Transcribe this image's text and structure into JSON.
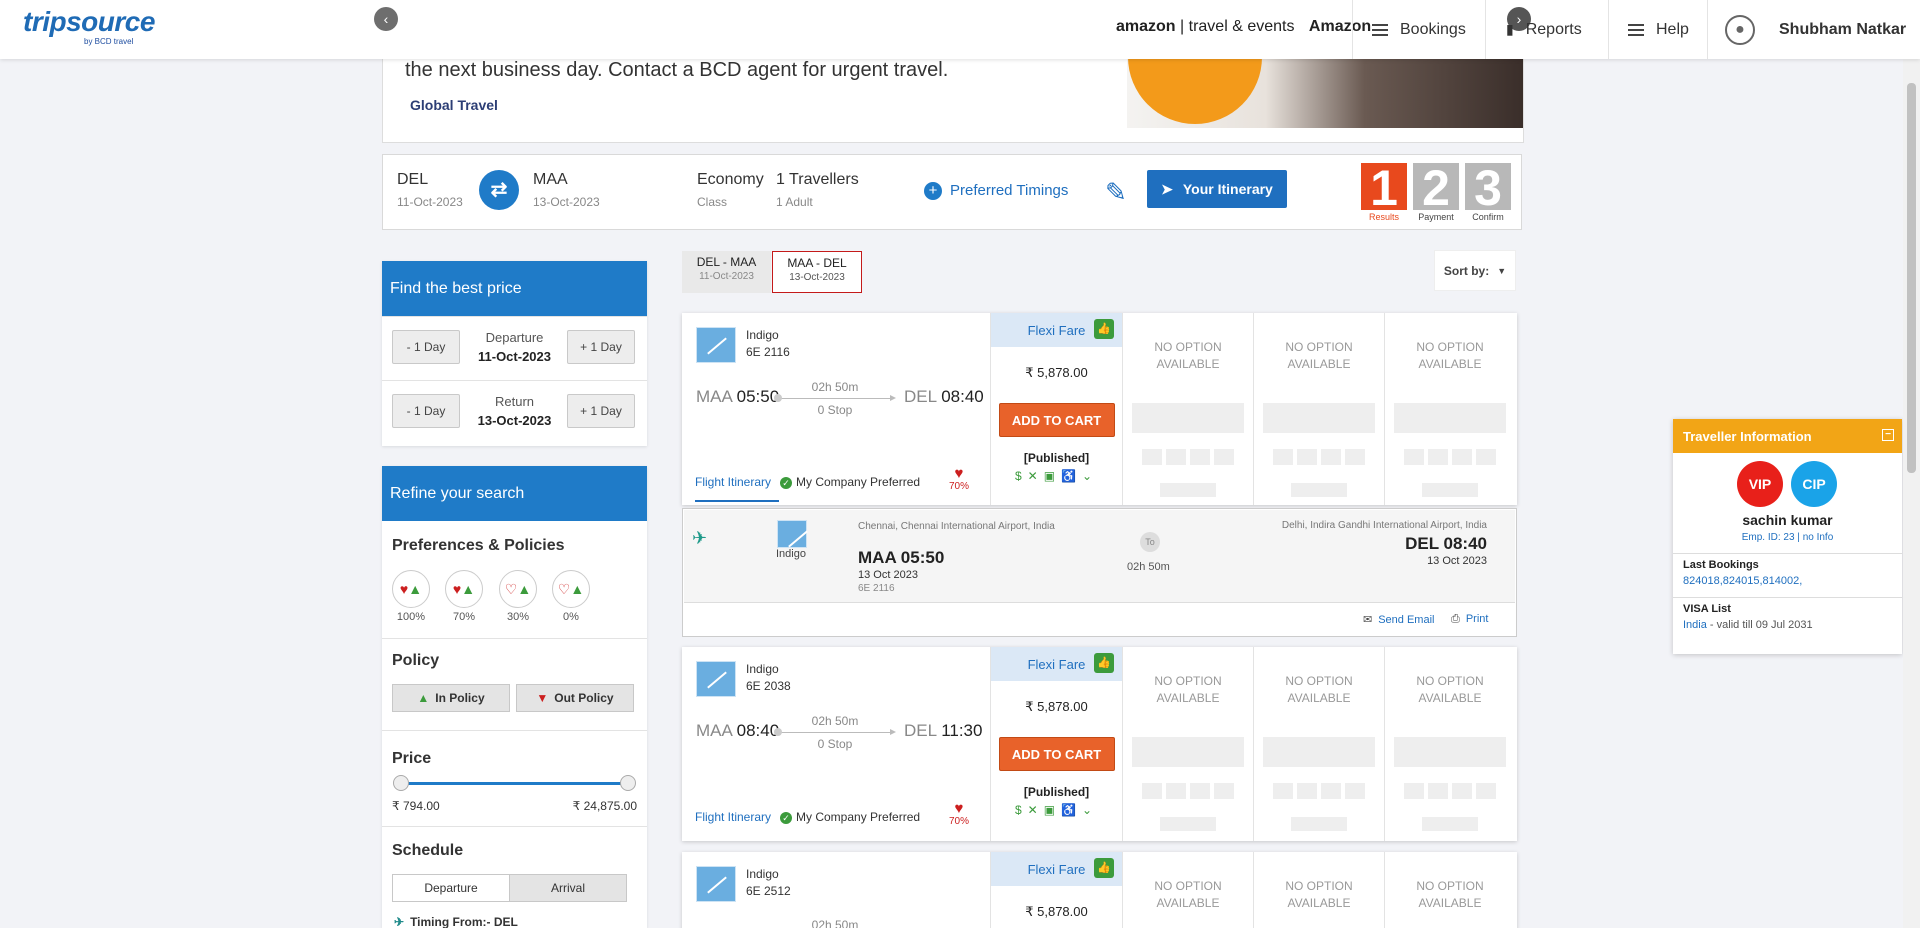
{
  "header": {
    "logo": "tripsource",
    "logo_sub": "by BCD travel",
    "amazon_brand": "amazon",
    "amazon_tagline": "travel & events",
    "amazon_label": "Amazon",
    "bookings": "Bookings",
    "reports": "Reports",
    "help": "Help",
    "user": "Shubham Natkar"
  },
  "banner": {
    "message": "the next business day. Contact a BCD agent for urgent travel.",
    "brand": "Global Travel"
  },
  "search": {
    "from_code": "DEL",
    "from_date": "11-Oct-2023",
    "to_code": "MAA",
    "to_date": "13-Oct-2023",
    "class": "Economy",
    "class_label": "Class",
    "travellers": "1 Travellers",
    "travellers_sub": "1 Adult",
    "preferred_timings": "Preferred Timings",
    "itinerary_button": "Your Itinerary",
    "steps": [
      {
        "num": "1",
        "label": "Results",
        "color": "#e8491d"
      },
      {
        "num": "2",
        "label": "Payment",
        "color": "#b8b8b8"
      },
      {
        "num": "3",
        "label": "Confirm",
        "color": "#b8b8b8"
      }
    ]
  },
  "best_price": {
    "title": "Find the best price",
    "minus_day": "- 1 Day",
    "plus_day": "+ 1 Day",
    "departure_label": "Departure",
    "departure_date": "11-Oct-2023",
    "return_label": "Return",
    "return_date": "13-Oct-2023"
  },
  "refine": {
    "title": "Refine your search",
    "preferences_title": "Preferences & Policies",
    "preference_levels": [
      "100%",
      "70%",
      "30%",
      "0%"
    ],
    "policy_title": "Policy",
    "in_policy": "In Policy",
    "out_policy": "Out Policy",
    "price_title": "Price",
    "price_min": "₹ 794.00",
    "price_max": "₹ 24,875.00",
    "schedule_title": "Schedule",
    "departure_tab": "Departure",
    "arrival_tab": "Arrival",
    "timing_from": "Timing From:- DEL"
  },
  "route_tabs": [
    {
      "route": "DEL - MAA",
      "date": "11-Oct-2023"
    },
    {
      "route": "MAA - DEL",
      "date": "13-Oct-2023"
    }
  ],
  "sort_label": "Sort by:",
  "flights": [
    {
      "airline": "Indigo",
      "number": "6E 2116",
      "dep_code": "MAA",
      "dep_time": "05:50",
      "arr_code": "DEL",
      "arr_time": "08:40",
      "duration": "02h 50m",
      "stops": "0 Stop",
      "itinerary_link": "Flight Itinerary",
      "company_pref": "My Company Preferred",
      "pref_pct": "70%",
      "fare_name": "Flexi Fare",
      "price": "₹ 5,878.00",
      "cart": "ADD TO CART",
      "fare_type": "[Published]",
      "no_option": "NO OPTION AVAILABLE"
    },
    {
      "airline": "Indigo",
      "number": "6E 2038",
      "dep_code": "MAA",
      "dep_time": "08:40",
      "arr_code": "DEL",
      "arr_time": "11:30",
      "duration": "02h 50m",
      "stops": "0 Stop",
      "itinerary_link": "Flight Itinerary",
      "company_pref": "My Company Preferred",
      "pref_pct": "70%",
      "fare_name": "Flexi Fare",
      "price": "₹ 5,878.00",
      "cart": "ADD TO CART",
      "fare_type": "[Published]",
      "no_option": "NO OPTION AVAILABLE"
    },
    {
      "airline": "Indigo",
      "number": "6E 2512",
      "duration": "02h 50m",
      "fare_name": "Flexi Fare",
      "price": "₹ 5,878.00",
      "no_option": "NO OPTION AVAILABLE"
    }
  ],
  "detail": {
    "airline": "Indigo",
    "dep_airport": "Chennai, Chennai International Airport, India",
    "dep": "MAA 05:50",
    "dep_date": "13 Oct 2023",
    "flight_no": "6E 2116",
    "to": "To",
    "duration": "02h 50m",
    "arr_airport": "Delhi, Indira Gandhi International Airport, India",
    "arr": "DEL 08:40",
    "arr_date": "13 Oct 2023",
    "send_email": "Send Email",
    "print": "Print"
  },
  "traveller": {
    "title": "Traveller Information",
    "vip": "VIP",
    "cip": "CIP",
    "name": "sachin kumar",
    "emp_id": "Emp. ID: 23",
    "no_info": "no Info",
    "last_bookings_label": "Last Bookings",
    "last_bookings": "824018,824015,814002,",
    "visa_label": "VISA List",
    "visa_country": "India",
    "visa_valid": " - valid till 09 Jul 2031"
  }
}
